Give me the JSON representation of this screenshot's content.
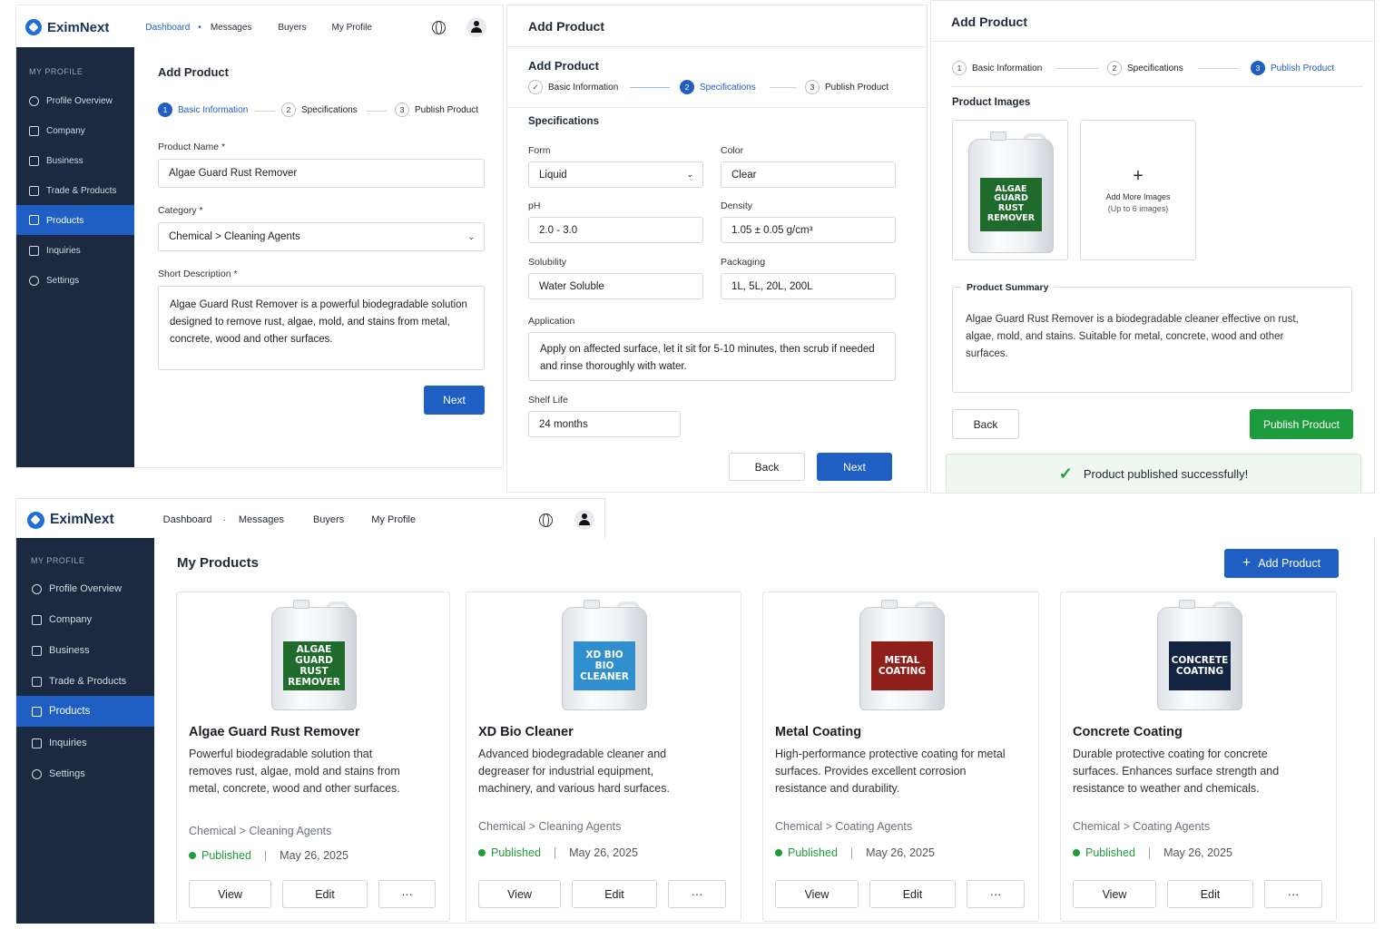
{
  "brand": "EximNext",
  "nav": [
    "Dashboard",
    "Messages",
    "Buyers",
    "My Profile"
  ],
  "sidebar": {
    "heading": "MY PROFILE",
    "items": [
      "Profile Overview",
      "Company",
      "Business",
      "Trade & Products",
      "Products",
      "Inquiries",
      "Settings"
    ],
    "active_index": 4
  },
  "steps": [
    "Basic Information",
    "Specifications",
    "Publish Product"
  ],
  "panel1": {
    "title": "Add Product",
    "product_name_label": "Product Name *",
    "product_name_value": "Algae Guard Rust Remover",
    "category_label": "Category *",
    "category_value": "Chemical > Cleaning Agents",
    "short_desc_label": "Short Description *",
    "short_desc_value": "Algae Guard Rust Remover is a powerful biodegradable solution designed to remove rust, algae, mold, and stains from metal, concrete, wood and other surfaces.",
    "next": "Next"
  },
  "panel2": {
    "header": "Add Product",
    "title": "Add Product",
    "section": "Specifications",
    "form_label": "Form",
    "form_value": "Liquid",
    "color_label": "Color",
    "color_value": "Clear",
    "ph_label": "pH",
    "ph_value": "2.0 - 3.0",
    "density_label": "Density",
    "density_value": "1.05 ± 0.05 g/cm³",
    "solubility_label": "Solubility",
    "solubility_value": "Water Soluble",
    "packaging_label": "Packaging",
    "packaging_value": "1L, 5L, 20L, 200L",
    "application_label": "Application",
    "application_value": "Apply on affected surface, let it sit for 5-10 minutes, then scrub if needed and rinse thoroughly with water.",
    "shelf_label": "Shelf Life",
    "shelf_value": "24 months",
    "back": "Back",
    "next": "Next"
  },
  "panel3": {
    "title": "Add Product",
    "images_label": "Product Images",
    "jug_label_line1": "ALGAE GUARD",
    "jug_label_line2": "RUST REMOVER",
    "add_more": "Add More Images",
    "add_more_sub": "(Up to 6 images)",
    "summary_label": "Product Summary",
    "summary_text": "Algae Guard Rust Remover is a biodegradable cleaner effective on rust, algae, mold, and stains. Suitable for metal, concrete, wood and other surfaces.",
    "back": "Back",
    "publish": "Publish Product",
    "success": "Product published successfully!",
    "colors": {
      "publish": "#1e9b3c",
      "success_bg": "#eef8ee"
    }
  },
  "products_page": {
    "title": "My Products",
    "add_button": "Add Product",
    "actions": [
      "View",
      "Edit",
      "···"
    ],
    "products": [
      {
        "jug1": "ALGAE GUARD",
        "jug2": "RUST REMOVER",
        "color": "#1e6b2c",
        "name": "Algae Guard Rust Remover",
        "desc": "Powerful biodegradable solution that removes rust, algae, mold and stains from metal, concrete, wood and other surfaces.",
        "category": "Chemical > Cleaning Agents",
        "status": "Published",
        "date": "May 26, 2025"
      },
      {
        "jug1": "XD BIO",
        "jug2": "BIO CLEANER",
        "color": "#2f8fcf",
        "name": "XD Bio Cleaner",
        "desc": "Advanced biodegradable cleaner and degreaser for industrial equipment, machinery, and various hard surfaces.",
        "category": "Chemical > Cleaning Agents",
        "status": "Published",
        "date": "May 26, 2025"
      },
      {
        "jug1": "METAL",
        "jug2": "COATING",
        "color": "#8e1f1a",
        "name": "Metal Coating",
        "desc": "High-performance protective coating for metal surfaces. Provides excellent corrosion resistance and durability.",
        "category": "Chemical > Coating Agents",
        "status": "Published",
        "date": "May 26, 2025"
      },
      {
        "jug1": "CONCRETE",
        "jug2": "COATING",
        "color": "#12243f",
        "name": "Concrete Coating",
        "desc": "Durable protective coating for concrete surfaces. Enhances surface strength and resistance to weather and chemicals.",
        "category": "Chemical > Coating Agents",
        "status": "Published",
        "date": "May 26, 2025"
      }
    ]
  },
  "colors": {
    "primary": "#1f5fc4",
    "sidebar": "#1b2a40",
    "published": "#1f9d3a"
  }
}
